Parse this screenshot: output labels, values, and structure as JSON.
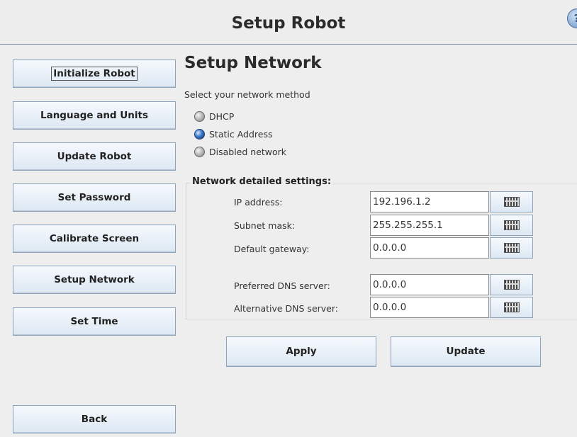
{
  "header": {
    "title": "Setup Robot",
    "help_label": "?"
  },
  "sidebar": {
    "items": [
      {
        "label": "Initialize Robot"
      },
      {
        "label": "Language and Units"
      },
      {
        "label": "Update Robot"
      },
      {
        "label": "Set Password"
      },
      {
        "label": "Calibrate Screen"
      },
      {
        "label": "Setup Network"
      },
      {
        "label": "Set Time"
      }
    ],
    "back_label": "Back"
  },
  "main": {
    "title": "Setup Network",
    "select_label": "Select your network method",
    "methods": [
      {
        "label": "DHCP",
        "selected": false
      },
      {
        "label": "Static Address",
        "selected": true
      },
      {
        "label": "Disabled network",
        "selected": false
      }
    ],
    "settings": {
      "legend": "Network detailed settings:",
      "fields": [
        {
          "label": "IP address:",
          "value": "192.196.1.2"
        },
        {
          "label": "Subnet mask:",
          "value": "255.255.255.1"
        },
        {
          "label": "Default gateway:",
          "value": "0.0.0.0"
        },
        {
          "label": "Preferred DNS server:",
          "value": "0.0.0.0"
        },
        {
          "label": "Alternative DNS server:",
          "value": "0.0.0.0"
        }
      ]
    },
    "apply_label": "Apply",
    "update_label": "Update"
  },
  "icons": {
    "help": "help-icon",
    "keyboard": "keyboard-icon",
    "radio_selected": "radio-selected-icon",
    "radio_unselected": "radio-unselected-icon"
  },
  "colors": {
    "background": "#eeeeee",
    "button_top": "#f5f9fd",
    "button_bottom": "#dde8f3",
    "button_border": "#8da3ba",
    "header_line": "#7f99b3",
    "radio_selected": "#3e78c9"
  }
}
